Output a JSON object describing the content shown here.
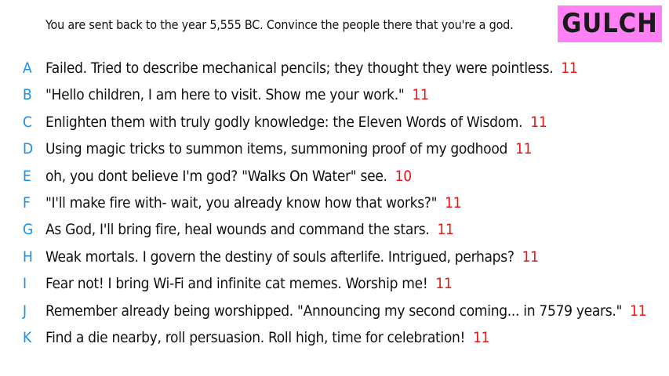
{
  "prompt": "You are sent back to the year 5,555 BC. Convince the people there that you're a god.",
  "brand": "GULCH",
  "colors": {
    "letter": "#1a8fe6",
    "score": "#e81515",
    "brand_bg": "#ff80f4"
  },
  "answers": [
    {
      "letter": "A",
      "text": "Failed. Tried to describe mechanical pencils; they thought they were pointless.",
      "score": "11"
    },
    {
      "letter": "B",
      "text": "\"Hello children, I am here to visit. Show me your work.\"",
      "score": "11"
    },
    {
      "letter": "C",
      "text": "Enlighten them with truly godly knowledge: the Eleven Words of Wisdom.",
      "score": "11"
    },
    {
      "letter": "D",
      "text": "Using magic tricks to summon items, summoning proof of my godhood",
      "score": "11"
    },
    {
      "letter": "E",
      "text": "oh, you dont believe I'm god? \"Walks On Water\" see.",
      "score": "10"
    },
    {
      "letter": "F",
      "text": "\"I'll make fire with- wait, you already know how that works?\"",
      "score": "11"
    },
    {
      "letter": "G",
      "text": "As God, I'll bring fire, heal wounds and command the stars.",
      "score": "11"
    },
    {
      "letter": "H",
      "text": "Weak mortals. I govern the destiny of souls afterlife. Intrigued, perhaps?",
      "score": "11"
    },
    {
      "letter": "I",
      "text": "Fear not! I bring Wi-Fi and infinite cat memes. Worship me!",
      "score": "11"
    },
    {
      "letter": "J",
      "text": "Remember already being worshipped. \"Announcing my second coming... in 7579 years.\"",
      "score": "11"
    },
    {
      "letter": "K",
      "text": "Find a die nearby, roll persuasion. Roll high, time for celebration!",
      "score": "11"
    }
  ]
}
